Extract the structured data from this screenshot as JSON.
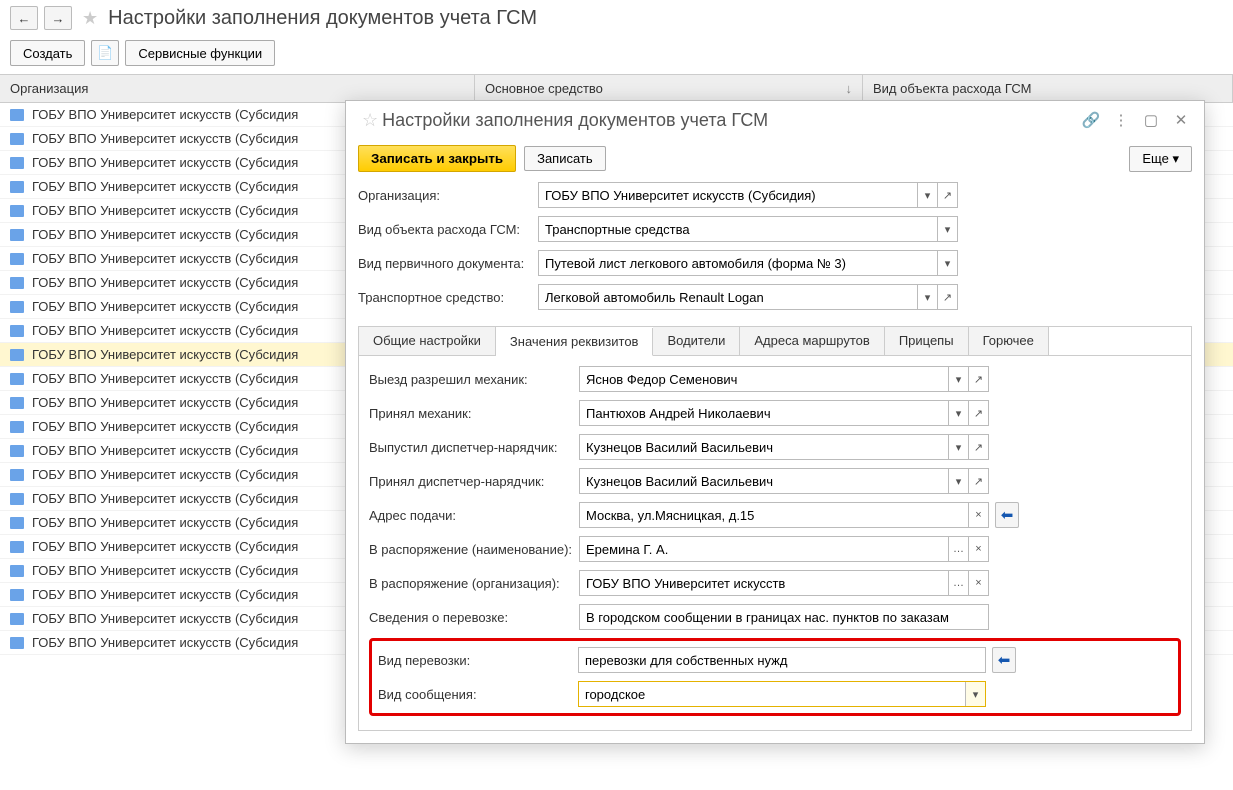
{
  "page": {
    "title": "Настройки заполнения документов учета ГСМ"
  },
  "toolbar": {
    "create": "Создать",
    "service_functions": "Сервисные функции"
  },
  "grid": {
    "columns": {
      "org": "Организация",
      "asset": "Основное средство",
      "type": "Вид объекта расхода ГСМ"
    },
    "rows": [
      "ГОБУ ВПО Университет искусств (Субсидия",
      "ГОБУ ВПО Университет искусств (Субсидия",
      "ГОБУ ВПО Университет искусств (Субсидия",
      "ГОБУ ВПО Университет искусств (Субсидия",
      "ГОБУ ВПО Университет искусств (Субсидия",
      "ГОБУ ВПО Университет искусств (Субсидия",
      "ГОБУ ВПО Университет искусств (Субсидия",
      "ГОБУ ВПО Университет искусств (Субсидия",
      "ГОБУ ВПО Университет искусств (Субсидия",
      "ГОБУ ВПО Университет искусств (Субсидия",
      "ГОБУ ВПО Университет искусств (Субсидия",
      "ГОБУ ВПО Университет искусств (Субсидия",
      "ГОБУ ВПО Университет искусств (Субсидия",
      "ГОБУ ВПО Университет искусств (Субсидия",
      "ГОБУ ВПО Университет искусств (Субсидия",
      "ГОБУ ВПО Университет искусств (Субсидия",
      "ГОБУ ВПО Университет искусств (Субсидия",
      "ГОБУ ВПО Университет искусств (Субсидия",
      "ГОБУ ВПО Университет искусств (Субсидия",
      "ГОБУ ВПО Университет искусств (Субсидия",
      "ГОБУ ВПО Университет искусств (Субсидия",
      "ГОБУ ВПО Университет искусств (Субсидия",
      "ГОБУ ВПО Университет искусств (Субсидия"
    ],
    "selected_index": 10
  },
  "dialog": {
    "title": "Настройки заполнения документов учета ГСМ",
    "save_close": "Записать и закрыть",
    "save": "Записать",
    "more": "Еще",
    "fields": {
      "org_label": "Организация:",
      "org_value": "ГОБУ ВПО Университет искусств (Субсидия)",
      "type_label": "Вид объекта расхода ГСМ:",
      "type_value": "Транспортные средства",
      "doc_label": "Вид первичного документа:",
      "doc_value": "Путевой лист легкового автомобиля (форма № 3)",
      "vehicle_label": "Транспортное средство:",
      "vehicle_value": "Легковой автомобиль Renault Logan"
    },
    "tabs": [
      "Общие настройки",
      "Значения реквизитов",
      "Водители",
      "Адреса маршрутов",
      "Прицепы",
      "Горючее"
    ],
    "active_tab": 1,
    "tabpage": {
      "depart_label": "Выезд разрешил механик:",
      "depart_value": "Яснов Федор Семенович",
      "receive_label": "Принял механик:",
      "receive_value": "Пантюхов Андрей Николаевич",
      "release_label": "Выпустил диспетчер-нарядчик:",
      "release_value": "Кузнецов Василий Васильевич",
      "accept_label": "Принял диспетчер-нарядчик:",
      "accept_value": "Кузнецов Василий Васильевич",
      "address_label": "Адрес подачи:",
      "address_value": "Москва, ул.Мясницкая, д.15",
      "disposal_name_label": "В распоряжение (наименование):",
      "disposal_name_value": "Еремина Г. А.",
      "disposal_org_label": "В распоряжение (организация):",
      "disposal_org_value": "ГОБУ ВПО Университет искусств",
      "transport_info_label": "Сведения о перевозке:",
      "transport_info_value": "В городском сообщении в границах нас. пунктов по заказам",
      "transport_type_label": "Вид перевозки:",
      "transport_type_value": "перевозки для собственных нужд",
      "message_type_label": "Вид сообщения:",
      "message_type_value": "городское"
    }
  }
}
